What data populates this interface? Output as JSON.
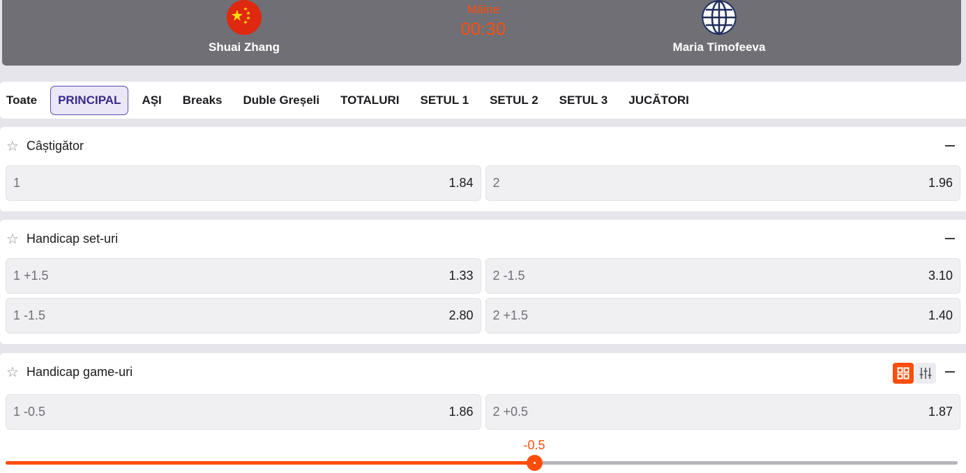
{
  "match": {
    "home_team": "Shuai Zhang",
    "away_team": "Maria Timofeeva",
    "day": "Mâine",
    "time": "00:30",
    "home_flag": "china-flag-icon",
    "away_flag": "globe-icon"
  },
  "tabs": [
    {
      "label": "Toate",
      "active": false
    },
    {
      "label": "PRINCIPAL",
      "active": true
    },
    {
      "label": "AȘI",
      "active": false
    },
    {
      "label": "Breaks",
      "active": false
    },
    {
      "label": "Duble Greșeli",
      "active": false
    },
    {
      "label": "TOTALURI",
      "active": false
    },
    {
      "label": "SETUL 1",
      "active": false
    },
    {
      "label": "SETUL 2",
      "active": false
    },
    {
      "label": "SETUL 3",
      "active": false
    },
    {
      "label": "JUCĂTORI",
      "active": false
    }
  ],
  "markets": [
    {
      "title": "Câștigător",
      "rows": [
        [
          {
            "label": "1",
            "odd": "1.84"
          },
          {
            "label": "2",
            "odd": "1.96"
          }
        ]
      ]
    },
    {
      "title": "Handicap set-uri",
      "rows": [
        [
          {
            "label": "1 +1.5",
            "odd": "1.33"
          },
          {
            "label": "2 -1.5",
            "odd": "3.10"
          }
        ],
        [
          {
            "label": "1 -1.5",
            "odd": "2.80"
          },
          {
            "label": "2 +1.5",
            "odd": "1.40"
          }
        ]
      ]
    },
    {
      "title": "Handicap game-uri",
      "rows": [
        [
          {
            "label": "1 -0.5",
            "odd": "1.86"
          },
          {
            "label": "2 +0.5",
            "odd": "1.87"
          }
        ]
      ]
    }
  ],
  "slider": {
    "value_label": "-0.5",
    "position_fraction": 0.555
  },
  "colors": {
    "accent": "#ff4d0a",
    "header_bg": "#706f76",
    "active_tab": "#3a2a8c"
  }
}
